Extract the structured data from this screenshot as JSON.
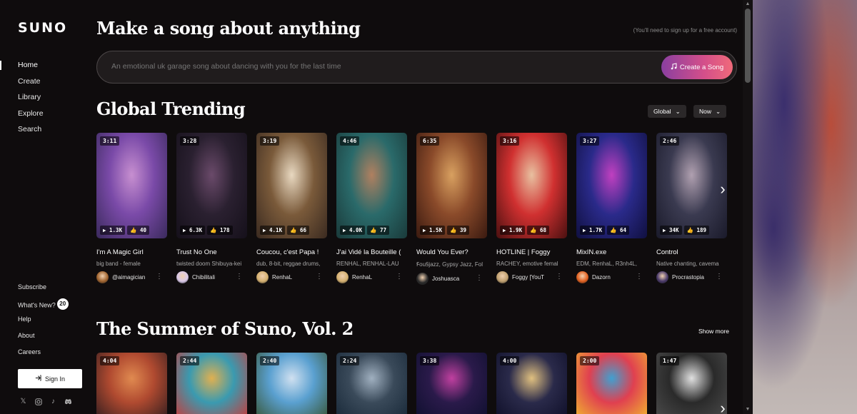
{
  "sidebar": {
    "logo": "SUNO",
    "nav": [
      "Home",
      "Create",
      "Library",
      "Explore",
      "Search"
    ],
    "bottom": [
      "Subscribe",
      "What's New?",
      "Help",
      "About",
      "Careers"
    ],
    "whats_new_badge": "20",
    "signin_label": "Sign In",
    "socials": [
      "x-icon",
      "instagram-icon",
      "tiktok-icon",
      "discord-icon"
    ]
  },
  "header": {
    "headline": "Make a song about anything",
    "signup_note": "(You'll need to sign up for a free account)"
  },
  "prompt": {
    "placeholder": "An emotional uk garage song about dancing with you for the last time",
    "button": "Create a Song"
  },
  "trending": {
    "title": "Global Trending",
    "filters": [
      "Global",
      "Now"
    ],
    "cards": [
      {
        "duration": "3:11",
        "plays": "1.3K",
        "likes": "40",
        "title": "I'm A Magic Girl",
        "tags": "big band - female",
        "user": "@aimagician",
        "colors": [
          "#7a4aa8",
          "#c78fd0",
          "#3a2a5c"
        ],
        "avatar": "#a0642f"
      },
      {
        "duration": "3:28",
        "plays": "6.3K",
        "likes": "178",
        "title": "Trust No One",
        "tags": "twisted doom Shibuya-kei",
        "user": "Chibilitali",
        "colors": [
          "#2a2030",
          "#6a4a6a",
          "#15101a"
        ],
        "avatar": "#d9c8e8"
      },
      {
        "duration": "3:19",
        "plays": "4.1K",
        "likes": "66",
        "title": "Coucou, c'est Papa !",
        "tags": "dub, 8-bit, reggae drums,",
        "user": "RenhaL",
        "colors": [
          "#7a5a3a",
          "#e8d8c0",
          "#3a2a20"
        ],
        "avatar": "#d4b070"
      },
      {
        "duration": "4:46",
        "plays": "4.0K",
        "likes": "77",
        "title": "J'ai Vidé la Bouteille (",
        "tags": "RENHAL, RENHAL-LAU",
        "user": "RenhaL",
        "colors": [
          "#2a6a6a",
          "#b08060",
          "#1a3a3a"
        ],
        "avatar": "#d4b070"
      },
      {
        "duration": "6:35",
        "plays": "1.5K",
        "likes": "39",
        "title": "Would You Ever?",
        "tags": "ꞘouꞨjazz, Gypsy Jazz, Fol",
        "user": "Joshuasca",
        "colors": [
          "#8a4a2a",
          "#d8a060",
          "#3a1a10"
        ],
        "avatar": "#2a2a2a"
      },
      {
        "duration": "3:16",
        "plays": "1.9K",
        "likes": "68",
        "title": "HOTLINE | Foggy",
        "tags": "RACHEY, emotive femal",
        "user": "Foggy [YouT",
        "colors": [
          "#d03030",
          "#e8c0a0",
          "#4a1010"
        ],
        "avatar": "#c0a070"
      },
      {
        "duration": "3:27",
        "plays": "1.7K",
        "likes": "64",
        "title": "MixIN.exe",
        "tags": "EDM, RenhaL, R3nh4L,",
        "user": "Dazorn",
        "colors": [
          "#2a2a8a",
          "#c040c0",
          "#101040"
        ],
        "avatar": "#e06020"
      },
      {
        "duration": "2:46",
        "plays": "34K",
        "likes": "189",
        "title": "Control",
        "tags": "Native chanting, cavema",
        "user": "Procrastopia",
        "colors": [
          "#3a3a50",
          "#b0a0b0",
          "#1a1a2a"
        ],
        "avatar": "#4a3a6a"
      }
    ]
  },
  "summer": {
    "title": "The Summer of Suno, Vol. 2",
    "show_more": "Show more",
    "cards": [
      {
        "duration": "4:04",
        "colors": [
          "#b04a30",
          "#e08a50",
          "#3a2020"
        ]
      },
      {
        "duration": "2:44",
        "colors": [
          "#3a9ab0",
          "#e0b050",
          "#c04040"
        ]
      },
      {
        "duration": "2:40",
        "colors": [
          "#5aa0d0",
          "#d0e0f0",
          "#3a5a40"
        ]
      },
      {
        "duration": "2:24",
        "colors": [
          "#3a4a5a",
          "#a0b0c0",
          "#1a2a3a"
        ]
      },
      {
        "duration": "3:38",
        "colors": [
          "#2a1a4a",
          "#c040a0",
          "#101030"
        ]
      },
      {
        "duration": "4:00",
        "colors": [
          "#2a2a4a",
          "#e0c080",
          "#10102a"
        ]
      },
      {
        "duration": "2:00",
        "colors": [
          "#e04050",
          "#40a0d0",
          "#f0b030"
        ]
      },
      {
        "duration": "1:47",
        "colors": [
          "#2a2a2a",
          "#e0e0e0",
          "#4a4a4a"
        ]
      }
    ]
  },
  "accent": "#d44f8a"
}
